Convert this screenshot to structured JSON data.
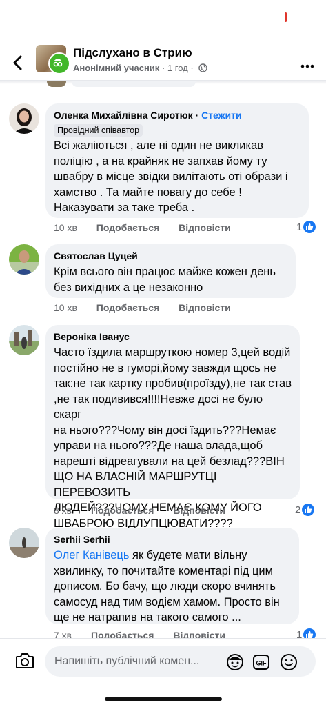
{
  "header": {
    "group_name": "Підслухано в Стрию",
    "author_label": "Анонімний учасник",
    "separator": "·",
    "time": "1 год"
  },
  "comments": [
    {
      "author": "Оленка Михайлівна Сиротюк",
      "follow": "Стежити",
      "badge": "Провідний співавтор",
      "text": "Всі жаліються , але ні один не викликав\nполіцію , а на крайняк не запхав йому ту\nшвабру в місце звідки вилітають оті образи  і\nхамство . Та майте повагу до себе !\nНаказувати за таке треба .",
      "time": "10 хв",
      "like": "Подобається",
      "reply": "Відповісти",
      "reactions": "1"
    },
    {
      "author": "Святослав Цуцей",
      "text": "Крім всього він працює майже кожен день\nбез вихідних а це незаконно",
      "time": "10 хв",
      "like": "Подобається",
      "reply": "Відповісти"
    },
    {
      "author": "Вероніка Іванус",
      "text": "Часто їздила маршруткою номер 3,цей водій\nпостійно не в гуморі,йому завжди щось не\nтак:не так картку пробив(проїзду),не так став\n,не так подивився!!!!Невже досі не було скарг\nна нього???Чому він досі їздить???Немає\nуправи на нього???Де наша влада,щоб\nнарешті відреагували на цей безлад???ВІН\nЩО НА ВЛАСНІЙ МАРШРУТЦІ ПЕРЕВОЗИТЬ\nЛЮДЕЙ???ЧОМУ НЕМАЄ КОМУ ЙОГО\nШВАБРОЮ ВІДЛУПЦЮВАТИ????",
      "time": "8 хв",
      "like": "Подобається",
      "reply": "Відповісти",
      "reactions": "2"
    },
    {
      "author": "Serhii Serhii",
      "mention": "Олег Канівець",
      "text": "як будете мати вільну\nхвилинку, то почитайте коментарі під цим\nдописом. Бо бачу, що люди скоро вчинять\nсамосуд над тим водієм хамом. Просто він\nще не натрапив на такого самого ...",
      "time": "7 хв",
      "like": "Подобається",
      "reply": "Відповісти",
      "reactions": "1"
    }
  ],
  "composer": {
    "placeholder": "Напишіть публічний комен..."
  },
  "icons": {
    "back": "back-arrow-icon",
    "more": "more-options-icon",
    "globe": "globe-icon",
    "camera": "camera-icon",
    "avatar_sticker": "avatar-sticker-icon",
    "gif": "gif-icon",
    "emoji": "emoji-icon",
    "like": "like-reaction-icon"
  },
  "colors": {
    "accent": "#1877f2",
    "bubble": "#f0f2f5",
    "secondary_text": "#65676b",
    "anon_badge": "#42b72a"
  }
}
